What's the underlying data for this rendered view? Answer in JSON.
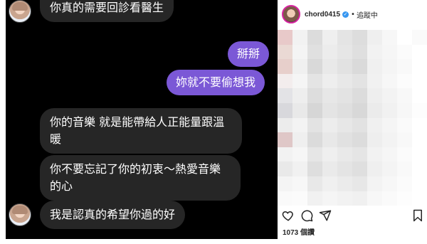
{
  "chat": {
    "messages": [
      {
        "direction": "in",
        "text_lines": [
          "你真的需要回診看醫生"
        ],
        "show_avatar": true
      },
      {
        "direction": "out",
        "text_lines": [
          "掰掰"
        ]
      },
      {
        "direction": "out",
        "text_lines": [
          "妳就不要偷想我"
        ]
      },
      {
        "direction": "in",
        "text_lines": [
          "你的音樂 就是能帶給人正能量跟溫",
          "暖"
        ],
        "show_avatar": false
      },
      {
        "direction": "in",
        "text_lines": [
          "你不要忘記了你的初衷～熱愛音樂",
          "的心"
        ],
        "show_avatar": false
      },
      {
        "direction": "in",
        "text_lines": [
          "我是認真的希望你過的好"
        ],
        "show_avatar": true
      }
    ],
    "colors": {
      "background": "#000000",
      "incoming_bubble": "#262626",
      "outgoing_bubble": "#7b58d6",
      "text": "#ffffff"
    }
  },
  "instagram": {
    "username": "chord0415",
    "verified_icon": "verified-badge-icon",
    "separator": "•",
    "follow_status": "追蹤中",
    "likes_text": "1073 個讚",
    "action_icons": [
      "heart-icon",
      "comment-icon",
      "share-icon",
      "bookmark-icon"
    ],
    "mosaic_colors": [
      "#e8c9c9",
      "#f2f2f2",
      "#dcdcdc",
      "#efefef",
      "#e4e4e4",
      "#dddddd",
      "#efefef",
      "#f7f7f7",
      "#ffffff",
      "#fafafa",
      "#ead9d4",
      "#f4f4f4",
      "#e0e0e0",
      "#ececec",
      "#e6e6e6",
      "#dfdfdf",
      "#f2f2f2",
      "#f6f6f6",
      "#fbfbfb",
      "#ffffff",
      "#e7cfcb",
      "#f0f0f0",
      "#d9d9d9",
      "#e9e9e9",
      "#e2e2e2",
      "#dadada",
      "#f0f0f0",
      "#f5f5f5",
      "#f9f9f9",
      "#ffffff",
      "#f3eded",
      "#f5f5f5",
      "#e4e4e4",
      "#eeeeee",
      "#e8e8e8",
      "#e3e3e3",
      "#f1f1f1",
      "#f7f7f7",
      "#fcfcfc",
      "#ffffff",
      "#e3e3e6",
      "#eeeeee",
      "#dddddd",
      "#e7e7e7",
      "#e3e3e3",
      "#dcdcdc",
      "#eeeeee",
      "#f3f3f3",
      "#f8f8f8",
      "#ffffff",
      "#d8d8dc",
      "#e9e9e9",
      "#d6d6d6",
      "#e4e4e4",
      "#dfdfdf",
      "#d8d8d8",
      "#ebebeb",
      "#f1f1f1",
      "#f7f7f7",
      "#fdfdfd",
      "#ececec",
      "#f3f3f3",
      "#e3e3e3",
      "#ededed",
      "#e7e7e7",
      "#e2e2e2",
      "#f0f0f0",
      "#f5f5f5",
      "#fafafa",
      "#ffffff",
      "#dfc7c7",
      "#efefef",
      "#dbdbdb",
      "#e8e8e8",
      "#e1e1e1",
      "#dcdcdc",
      "#eeeeee",
      "#f3f3f3",
      "#f8f8f8",
      "#ffffff",
      "#f2f2f2",
      "#f6f6f6",
      "#e6e6e6",
      "#efefef",
      "#e9e9e9",
      "#e5e5e5",
      "#f2f2f2",
      "#f6f6f6",
      "#fbfbfb",
      "#ffffff",
      "#e9e9e9",
      "#f1f1f1",
      "#dedede",
      "#eaeaea",
      "#e4e4e4",
      "#dfdfdf",
      "#efefef",
      "#f4f4f4",
      "#f9f9f9",
      "#ffffff",
      "#f4f4f4",
      "#f7f7f7",
      "#e8e8e8",
      "#f0f0f0",
      "#ebebeb",
      "#e7e7e7",
      "#f3f3f3",
      "#f7f7f7",
      "#fbfbfb",
      "#ffffff",
      "#fafafa",
      "#fbfbfb",
      "#f1f1f1",
      "#f5f5f5",
      "#f2f2f2",
      "#f0f0f0",
      "#f7f7f7",
      "#fafafa",
      "#fdfdfd",
      "#ffffff"
    ]
  }
}
